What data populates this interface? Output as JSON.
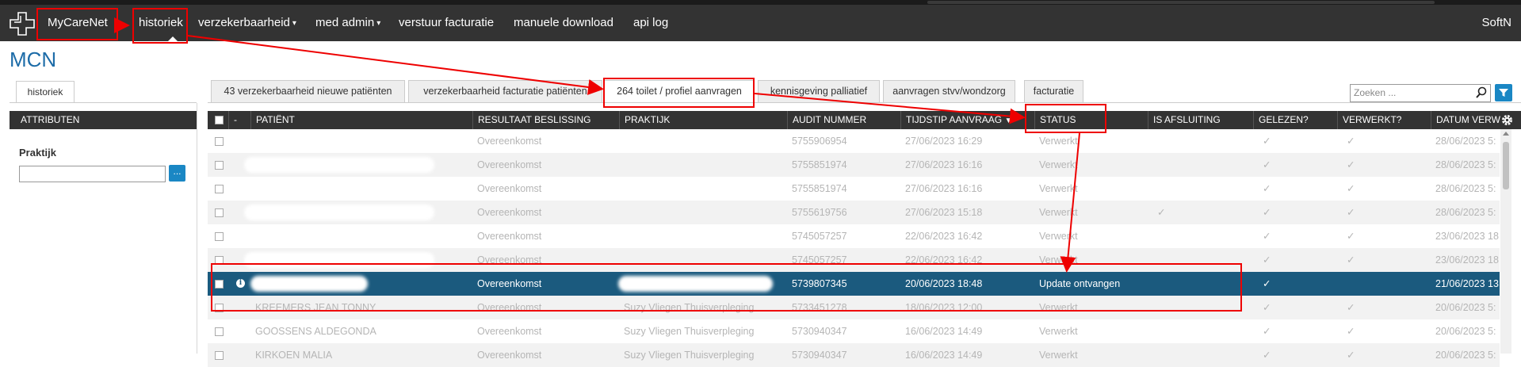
{
  "navbar": {
    "brand": "MyCareNet",
    "items": [
      {
        "label": "historiek"
      },
      {
        "label": "verzekerbaarheid",
        "caret": "▾"
      },
      {
        "label": "med admin",
        "caret": "▾"
      },
      {
        "label": "verstuur facturatie"
      },
      {
        "label": "manuele download"
      },
      {
        "label": "api log"
      }
    ],
    "user": "SoftN"
  },
  "page": {
    "title": "MCN"
  },
  "left": {
    "tab": "historiek",
    "section": "ATTRIBUTEN",
    "field_label": "Praktijk",
    "field_value": "",
    "browse_button": "...",
    "tab_icon": "arrow-icon",
    "praktijk_icon": "ellipsis-icon"
  },
  "tabs": [
    {
      "label": "43 verzekerbaarheid nieuwe patiënten"
    },
    {
      "label": "verzekerbaarheid facturatie patiënten"
    },
    {
      "label": "264 toilet / profiel aanvragen"
    },
    {
      "label": "kennisgeving palliatief"
    },
    {
      "label": "aanvragen stvv/wondzorg"
    },
    {
      "label": "facturatie"
    }
  ],
  "search": {
    "placeholder": "Zoeken ...",
    "icon": "search-icon",
    "filter_icon": "filter-icon"
  },
  "grid": {
    "columns": [
      "",
      "-",
      "PATIËNT",
      "RESULTAAT BESLISSING",
      "PRAKTIJK",
      "AUDIT NUMMER",
      "TIJDSTIP AANVRAAG",
      "STATUS",
      "IS AFSLUITING",
      "GELEZEN?",
      "VERWERKT?",
      "DATUM VERW"
    ],
    "sort_indicator": "▼",
    "settings_icon": "gear-icon",
    "rows": [
      {
        "patient": "",
        "resultaat": "Overeenkomst",
        "praktijk": "",
        "audit": "5755906954",
        "tijdstip": "27/06/2023 16:29",
        "status": "Verwerkt",
        "afsluiting": "",
        "gelezen": "✓",
        "verwerkt": "✓",
        "datum": "28/06/2023 5:"
      },
      {
        "patient": "",
        "resultaat": "Overeenkomst",
        "praktijk": "",
        "audit": "5755851974",
        "tijdstip": "27/06/2023 16:16",
        "status": "Verwerkt",
        "afsluiting": "",
        "gelezen": "✓",
        "verwerkt": "✓",
        "datum": "28/06/2023 5:"
      },
      {
        "patient": "",
        "resultaat": "Overeenkomst",
        "praktijk": "",
        "audit": "5755851974",
        "tijdstip": "27/06/2023 16:16",
        "status": "Verwerkt",
        "afsluiting": "",
        "gelezen": "✓",
        "verwerkt": "✓",
        "datum": "28/06/2023 5:"
      },
      {
        "patient": "",
        "resultaat": "Overeenkomst",
        "praktijk": "",
        "audit": "5755619756",
        "tijdstip": "27/06/2023 15:18",
        "status": "Verwerkt",
        "afsluiting": "✓",
        "gelezen": "✓",
        "verwerkt": "✓",
        "datum": "28/06/2023 5:"
      },
      {
        "patient": "",
        "resultaat": "Overeenkomst",
        "praktijk": "",
        "audit": "5745057257",
        "tijdstip": "22/06/2023 16:42",
        "status": "Verwerkt",
        "afsluiting": "",
        "gelezen": "✓",
        "verwerkt": "✓",
        "datum": "23/06/2023 18"
      },
      {
        "patient": "",
        "resultaat": "Overeenkomst",
        "praktijk": "",
        "audit": "5745057257",
        "tijdstip": "22/06/2023 16:42",
        "status": "Verwerkt",
        "afsluiting": "",
        "gelezen": "✓",
        "verwerkt": "✓",
        "datum": "23/06/2023 18"
      },
      {
        "patient": "",
        "resultaat": "Overeenkomst",
        "praktijk": "",
        "audit": "5739807345",
        "tijdstip": "20/06/2023 18:48",
        "status": "Update ontvangen",
        "afsluiting": "",
        "gelezen": "✓",
        "verwerkt": "",
        "datum": "21/06/2023 13",
        "info_icon": "info-icon"
      },
      {
        "patient": "KREEMERS JEAN TONNY",
        "resultaat": "Overeenkomst",
        "praktijk": "Suzy Vliegen Thuisverpleging",
        "audit": "5733451278",
        "tijdstip": "18/06/2023 12:00",
        "status": "Verwerkt",
        "afsluiting": "",
        "gelezen": "✓",
        "verwerkt": "✓",
        "datum": "20/06/2023 5:"
      },
      {
        "patient": "GOOSSENS ALDEGONDA",
        "resultaat": "Overeenkomst",
        "praktijk": "Suzy Vliegen Thuisverpleging",
        "audit": "5730940347",
        "tijdstip": "16/06/2023 14:49",
        "status": "Verwerkt",
        "afsluiting": "",
        "gelezen": "✓",
        "verwerkt": "✓",
        "datum": "20/06/2023 5:"
      },
      {
        "patient": "KIRKOEN MALIA",
        "resultaat": "Overeenkomst",
        "praktijk": "Suzy Vliegen Thuisverpleging",
        "audit": "5730940347",
        "tijdstip": "16/06/2023 14:49",
        "status": "Verwerkt",
        "afsluiting": "",
        "gelezen": "✓",
        "verwerkt": "✓",
        "datum": "20/06/2023 5:"
      }
    ]
  },
  "colors": {
    "navbar": "#333333",
    "accent": "#1a87c4",
    "selected_row": "#1b5a7e",
    "title": "#1d6ca8",
    "annotation": "#e00000"
  }
}
